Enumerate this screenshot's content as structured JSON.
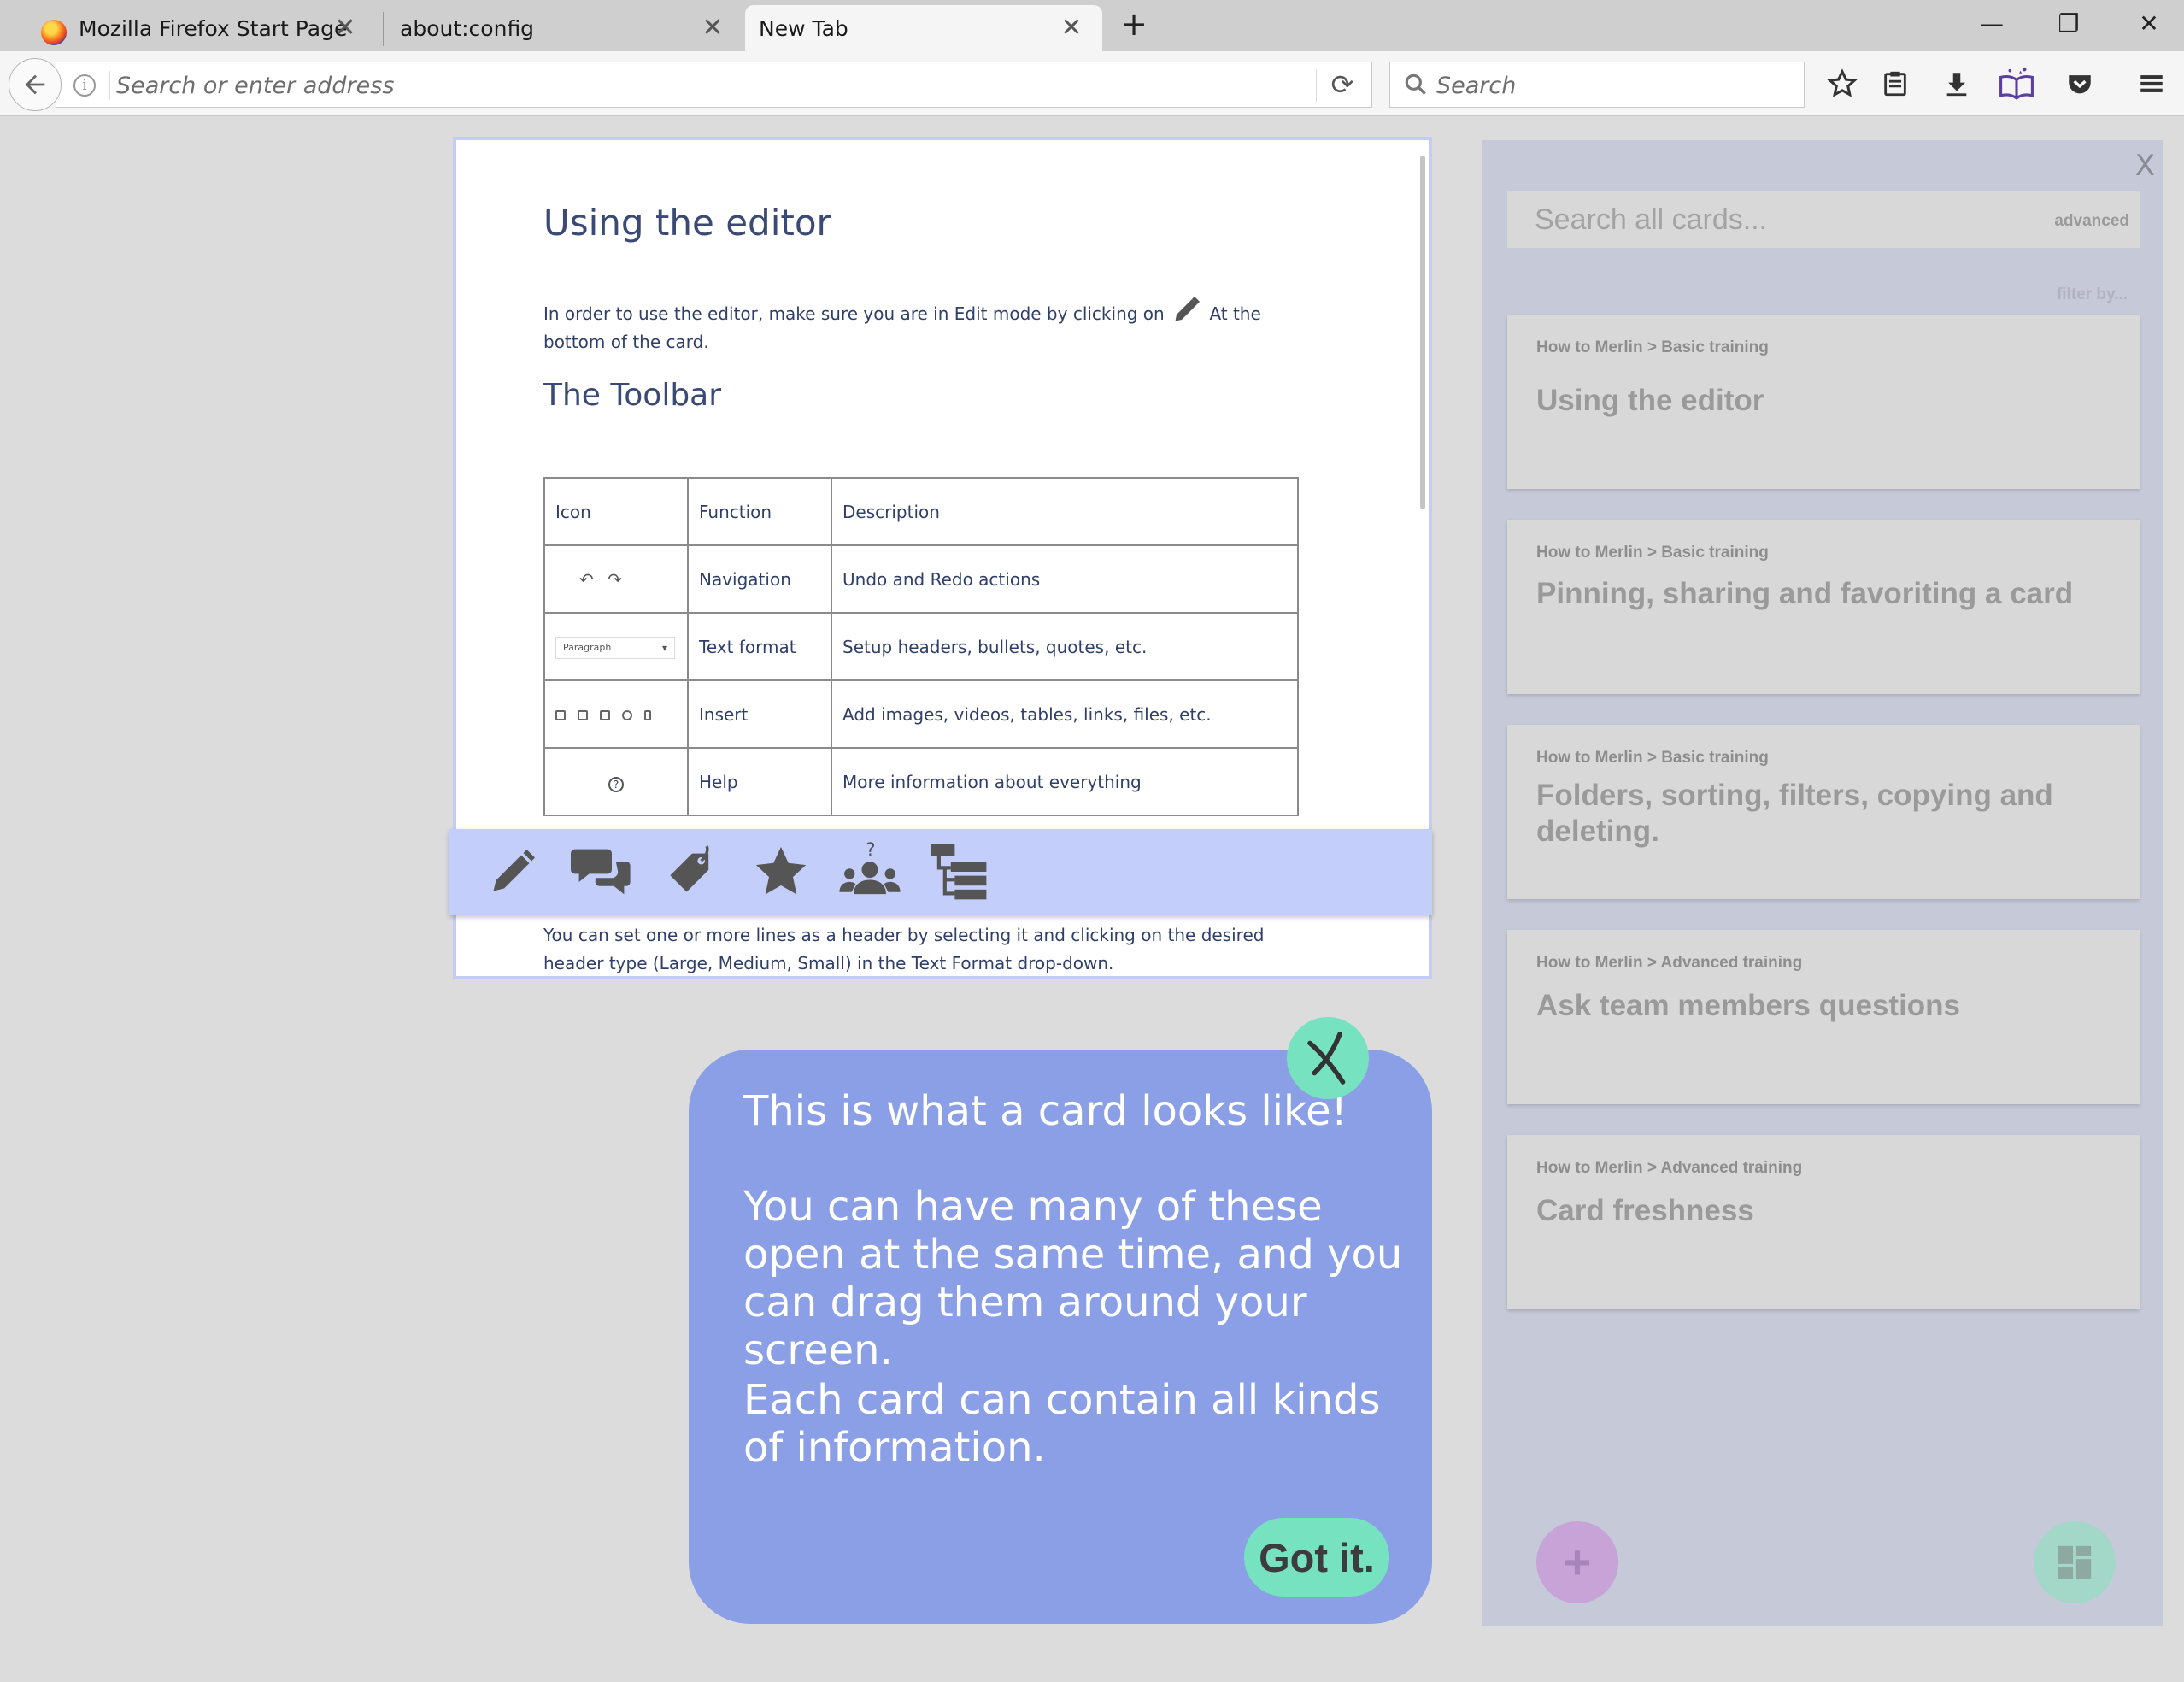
{
  "browser": {
    "tabs": [
      {
        "title": "Mozilla Firefox Start Page",
        "active": false,
        "icon": "firefox-icon"
      },
      {
        "title": "about:config",
        "active": false
      },
      {
        "title": "New Tab",
        "active": true
      }
    ],
    "new_tab_symbol": "+",
    "close_symbol": "✕",
    "window_controls": {
      "minimize": "—",
      "restore": "❐",
      "close": "✕"
    },
    "address_placeholder": "Search or enter address",
    "search_placeholder": "Search",
    "toolbar_icons": [
      "star-icon",
      "reading-list-icon",
      "download-icon",
      "book-addon-icon",
      "pocket-icon",
      "menu-icon"
    ]
  },
  "card": {
    "title": "Using the editor",
    "intro_part1": "In order to use the editor, make sure you are in Edit mode by clicking on",
    "intro_part2": "At the bottom of the card.",
    "toolbar_heading": "The Toolbar",
    "table": {
      "headers": [
        "Icon",
        "Function",
        "Description"
      ],
      "rows": [
        {
          "icon": "undo-redo-icons",
          "function": "Navigation",
          "description": "Undo and Redo actions"
        },
        {
          "icon": "paragraph-dropdown",
          "icon_label": "Paragraph",
          "function": "Text format",
          "description": "Setup headers, bullets, quotes, etc."
        },
        {
          "icon": "insert-icons",
          "function": "Insert",
          "description": "Add images, videos, tables, links, files, etc."
        },
        {
          "icon": "help-icon",
          "function": "Help",
          "description": "More information about everything"
        }
      ]
    },
    "lower_text": "You can set one or more lines as a header by selecting it and clicking on the desired header type (Large, Medium, Small) in the Text Format drop-down.",
    "toolbar_buttons": [
      "edit-pencil-icon",
      "comments-icon",
      "tag-icon",
      "favorite-star-icon",
      "ask-team-icon",
      "folder-tree-icon"
    ]
  },
  "sidebar": {
    "close_label": "X",
    "search_placeholder": "Search all cards...",
    "advanced_label": "advanced",
    "filter_label": "filter by...",
    "cards": [
      {
        "crumb": "How to Merlin > Basic training",
        "title": "Using the editor"
      },
      {
        "crumb": "How to Merlin > Basic training",
        "title": "Pinning, sharing and favoriting a card"
      },
      {
        "crumb": "How to Merlin > Basic training",
        "title": "Folders, sorting, filters, copying and deleting."
      },
      {
        "crumb": "How to Merlin > Advanced training",
        "title": "Ask team members questions"
      },
      {
        "crumb": "How to Merlin > Advanced training",
        "title": "Card freshness"
      }
    ],
    "add_button": "+",
    "colors": {
      "add_fab": "#c7a3d8",
      "dashboard_fab": "#a3d8c8"
    }
  },
  "tooltip": {
    "line1": "This is what a card looks like!",
    "line2": "You can have many of these open at the same time, and you can drag them around your screen.",
    "line3": "Each card can contain all kinds of information.",
    "button": "Got it.",
    "colors": {
      "bubble": "#8a9fe6",
      "accent": "#77e2c0"
    }
  }
}
